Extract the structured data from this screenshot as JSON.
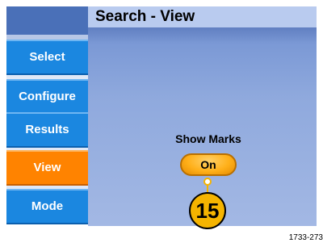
{
  "window": {
    "title": "Search - View"
  },
  "sidebar": {
    "items": [
      {
        "label": "Select",
        "active": false
      },
      {
        "label": "Configure",
        "active": false
      },
      {
        "label": "Results",
        "active": false
      },
      {
        "label": "View",
        "active": true
      },
      {
        "label": "Mode",
        "active": false
      }
    ]
  },
  "main": {
    "show_marks_label": "Show Marks",
    "show_marks_value": "On"
  },
  "callout": {
    "number": "15"
  },
  "figure_id": "1733-273",
  "colors": {
    "sidebar_button": "#1b87e0",
    "sidebar_active": "#ff8300",
    "panel": "#8fa9dd",
    "titlebar": "#b9cbef",
    "callout": "#f5b400"
  }
}
